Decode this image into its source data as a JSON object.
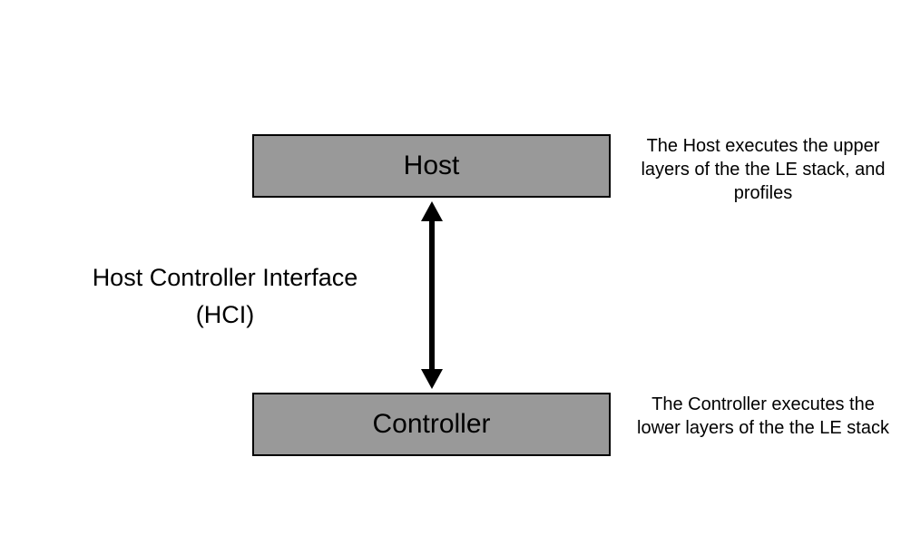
{
  "host_box": {
    "label": "Host"
  },
  "controller_box": {
    "label": "Controller"
  },
  "host_description": "The Host executes the upper layers of the the LE stack, and profiles",
  "controller_description": "The Controller executes the lower layers of the the LE stack",
  "interface_label_line1": "Host Controller Interface",
  "interface_label_line2": "(HCI)"
}
